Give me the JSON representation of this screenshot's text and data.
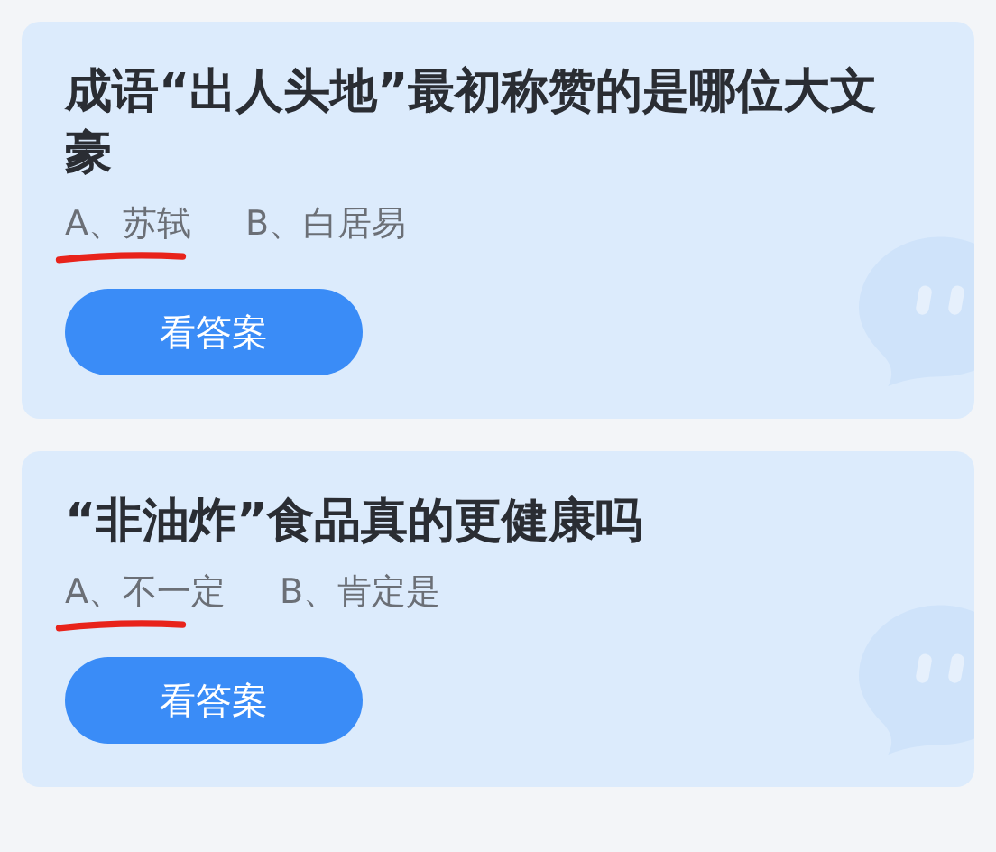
{
  "cards": [
    {
      "question": "成语“出人头地”最初称赞的是哪位大文豪",
      "options": [
        {
          "label": "A、苏轼",
          "marked": true
        },
        {
          "label": "B、白居易",
          "marked": false
        }
      ],
      "button": "看答案"
    },
    {
      "question": "“非油炸”食品真的更健康吗",
      "options": [
        {
          "label": "A、不一定",
          "marked": true
        },
        {
          "label": "B、肯定是",
          "marked": false
        }
      ],
      "button": "看答案"
    }
  ]
}
